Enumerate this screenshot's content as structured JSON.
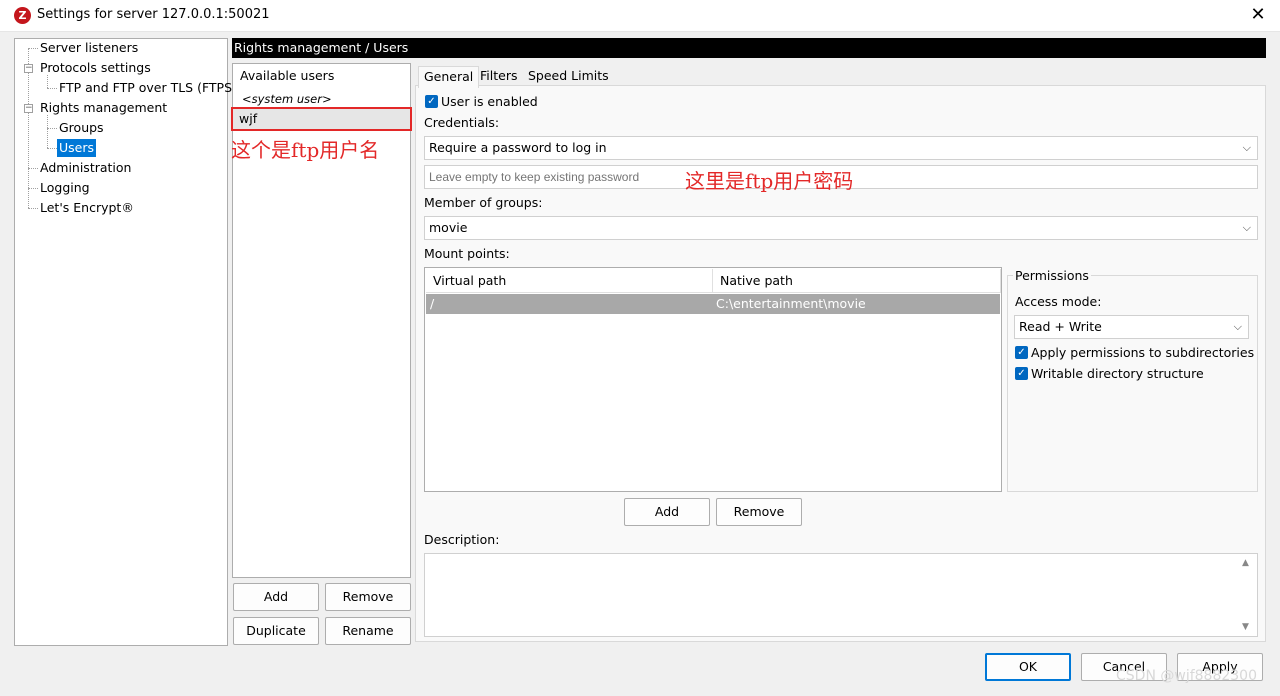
{
  "window": {
    "title": "Settings for server 127.0.0.1:50021",
    "app_icon": "Z",
    "close_glyph": "✕"
  },
  "tree": {
    "items": [
      {
        "label": "Server listeners"
      },
      {
        "label": "Protocols settings"
      },
      {
        "label": "FTP and FTP over TLS (FTPS)"
      },
      {
        "label": "Rights management"
      },
      {
        "label": "Groups"
      },
      {
        "label": "Users"
      },
      {
        "label": "Administration"
      },
      {
        "label": "Logging"
      },
      {
        "label": "Let's Encrypt®"
      }
    ],
    "selected": "Users"
  },
  "header": {
    "breadcrumb": "Rights management / Users"
  },
  "users": {
    "heading": "Available users",
    "system_user": "<system user>",
    "selected_user": "wjf",
    "annotation": "这个是ftp用户名",
    "buttons": {
      "add": "Add",
      "remove": "Remove",
      "duplicate": "Duplicate",
      "rename": "Rename"
    }
  },
  "tabs": [
    {
      "label": "General",
      "active": true
    },
    {
      "label": "Filters",
      "active": false
    },
    {
      "label": "Speed Limits",
      "active": false
    }
  ],
  "general": {
    "user_enabled_label": "User is enabled",
    "user_enabled": true,
    "credentials_label": "Credentials:",
    "credentials_value": "Require a password to log in",
    "password_placeholder": "Leave empty to keep existing password",
    "password_annotation": "这里是ftp用户密码",
    "groups_label": "Member of groups:",
    "groups_value": "movie",
    "mount_label": "Mount points:",
    "mount_columns": [
      "Virtual path",
      "Native path"
    ],
    "mount_rows": [
      {
        "virtual": "/",
        "native": "C:\\entertainment\\movie"
      }
    ],
    "mount_buttons": {
      "add": "Add",
      "remove": "Remove"
    },
    "permissions": {
      "title": "Permissions",
      "access_mode_label": "Access mode:",
      "access_mode_value": "Read + Write",
      "apply_subdirs_label": "Apply permissions to subdirectories",
      "writable_label": "Writable directory structure"
    },
    "description_label": "Description:"
  },
  "footer": {
    "ok": "OK",
    "cancel": "Cancel",
    "apply": "Apply"
  },
  "watermark": "CSDN @wjf8882300"
}
